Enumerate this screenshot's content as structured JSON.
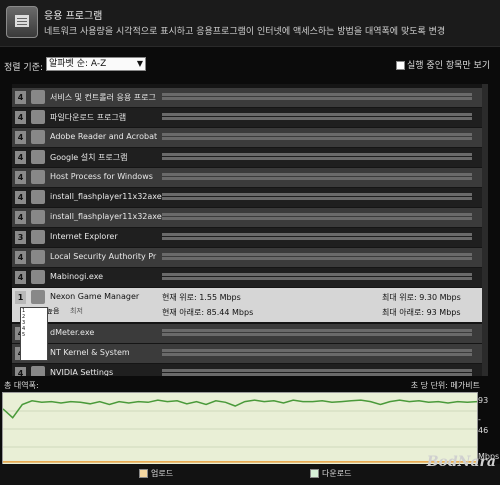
{
  "header": {
    "title": "응용 프로그램",
    "description": "네트워크 사용량을 시각적으로 표시하고 응용프로그램이 인터넷에 액세스하는 방법을 대역폭에 맞도록 변경"
  },
  "sort": {
    "label": "정렬 기준:",
    "selected": "알파벳 순: A-Z"
  },
  "filter": {
    "active_only_label": "실행 중인 항목만 보기",
    "checked": true
  },
  "apps": [
    {
      "priority": "4",
      "name": "서비스 및 컨트롤러 응용 프로그",
      "icon": "window-icon",
      "alt": false
    },
    {
      "priority": "4",
      "name": "파일다운로드 프로그램",
      "icon": "window-icon",
      "alt": true
    },
    {
      "priority": "4",
      "name": "Adobe Reader and Acrobat",
      "icon": "adobe-icon",
      "alt": false
    },
    {
      "priority": "4",
      "name": "Google 설치 프로그램",
      "icon": "google-icon",
      "alt": true
    },
    {
      "priority": "4",
      "name": "Host Process for Windows",
      "icon": "window-icon",
      "alt": false
    },
    {
      "priority": "4",
      "name": "install_flashplayer11x32axe",
      "icon": "flash-icon",
      "alt": true
    },
    {
      "priority": "4",
      "name": "install_flashplayer11x32axe",
      "icon": "flash-icon",
      "alt": false
    },
    {
      "priority": "3",
      "name": "Internet Explorer",
      "icon": "ie-icon",
      "alt": true
    },
    {
      "priority": "4",
      "name": "Local Security Authority Pr",
      "icon": "window-icon",
      "alt": false
    },
    {
      "priority": "4",
      "name": "Mabinogi.exe",
      "icon": "mabinogi-icon",
      "alt": true
    }
  ],
  "selected_app": {
    "priority": "1",
    "name": "Nexon Game Manager",
    "current_up": "현재 위로: 1.55 Mbps",
    "max_up": "최대 위로: 9.30 Mbps",
    "current_down": "현재 아래로: 85.44 Mbps",
    "max_down": "최대 아래로: 93 Mbps"
  },
  "after_rows": [
    {
      "priority": "4",
      "name": "dMeter.exe",
      "icon": "window-icon",
      "alt": false
    },
    {
      "priority": "4",
      "name": "NT Kernel & System",
      "icon": "window-icon",
      "alt": false
    },
    {
      "priority": "4",
      "name": "NVIDIA Settings",
      "icon": "nvidia-icon",
      "alt": true
    }
  ],
  "dropdown": {
    "priority_label": "1 - 가장 높음",
    "options": [
      "1",
      "2",
      "3",
      "4",
      "5"
    ],
    "low_label": "최저"
  },
  "graph": {
    "title": "총 대역폭:",
    "unit_label": "초 당 단위:",
    "unit_value": "메가비트",
    "y_top": "93",
    "y_mid": "46",
    "y_bottom": "-",
    "y_unit": "Mbps"
  },
  "legend": {
    "upload": "업로드",
    "download": "다운로드"
  },
  "watermark": "BodNara",
  "colors": {
    "upload": "#e8a040",
    "download": "#4a9a3a",
    "graph_bg": "#e9efd6"
  },
  "chart_data": {
    "type": "line",
    "ylim": [
      0,
      93
    ],
    "series": [
      {
        "name": "다운로드",
        "values": [
          74,
          62,
          80,
          85,
          83,
          84,
          82,
          84,
          83,
          81,
          84,
          80,
          84,
          82,
          84,
          83,
          86,
          84,
          85,
          81,
          84,
          80,
          85,
          83,
          78,
          84,
          86,
          84,
          85,
          82,
          86,
          84,
          84,
          85,
          83,
          84,
          85,
          86,
          84,
          80,
          84,
          86,
          84,
          85,
          83,
          84,
          82,
          84,
          83,
          84
        ]
      },
      {
        "name": "업로드",
        "values": [
          1.5,
          1.5,
          1.5,
          1.5,
          1.5,
          1.5,
          1.5,
          1.5,
          1.5,
          1.5,
          1.5,
          1.5,
          1.5,
          1.5,
          1.5,
          1.5,
          1.5,
          1.5,
          1.5,
          1.5,
          1.5,
          1.5,
          1.5,
          1.5,
          1.5,
          1.5,
          1.5,
          1.5,
          1.5,
          1.5,
          1.5,
          1.5,
          1.5,
          1.5,
          1.5,
          1.5,
          1.5,
          1.5,
          1.5,
          1.5,
          1.5,
          1.5,
          1.5,
          1.5,
          1.5,
          1.5,
          1.5,
          1.5,
          1.5,
          1.5
        ]
      }
    ]
  }
}
